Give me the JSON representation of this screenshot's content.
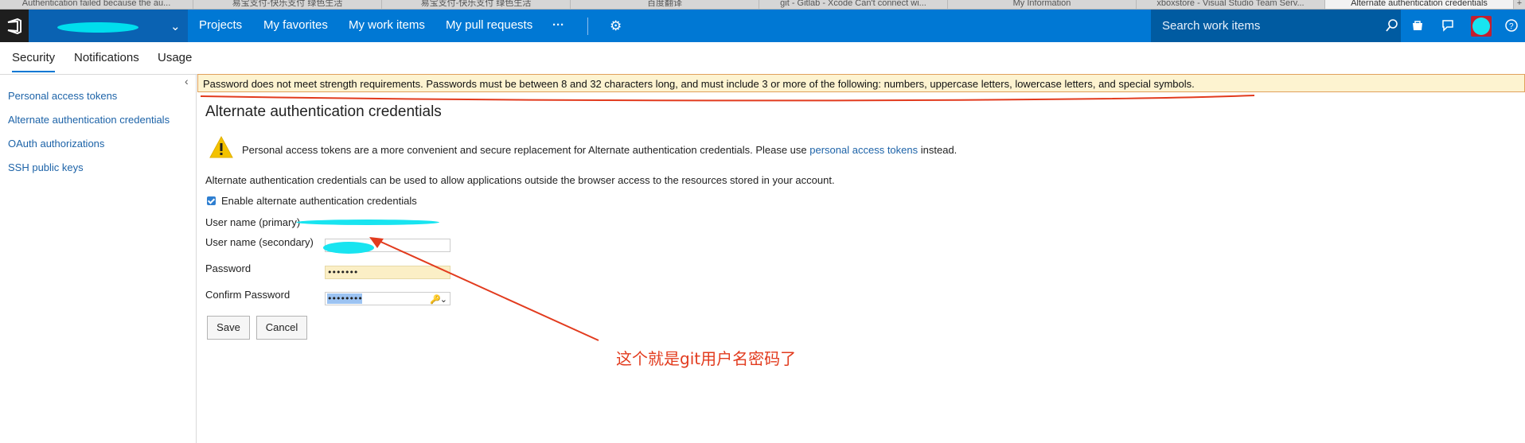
{
  "browser_tabs": [
    {
      "label": "Authentication failed because the au...",
      "active": false
    },
    {
      "label": "易宝支付-快乐支付 绿色生活",
      "active": false
    },
    {
      "label": "易宝支付-快乐支付 绿色生活",
      "active": false
    },
    {
      "label": "百度翻译",
      "active": false
    },
    {
      "label": "git - Gitlab - Xcode Can't connect wi...",
      "active": false
    },
    {
      "label": "My Information",
      "active": false
    },
    {
      "label": "xboxstore - Visual Studio Team Serv...",
      "active": false
    },
    {
      "label": "Alternate authentication credentials",
      "active": true
    }
  ],
  "topnav": {
    "items": [
      "Projects",
      "My favorites",
      "My work items",
      "My pull requests"
    ],
    "more": "···",
    "search_placeholder": "Search work items"
  },
  "subtabs": [
    "Security",
    "Notifications",
    "Usage"
  ],
  "sidebar": {
    "collapse": "‹",
    "links": [
      "Personal access tokens",
      "Alternate authentication credentials",
      "OAuth authorizations",
      "SSH public keys"
    ]
  },
  "banner": {
    "text": "Password does not meet strength requirements. Passwords must be between 8 and 32 characters long, and must include 3 or more of the following: numbers, uppercase letters, lowercase letters, and special symbols."
  },
  "main": {
    "title": "Alternate authentication credentials",
    "note_prefix": "Personal access tokens are a more convenient and secure replacement for Alternate authentication credentials. Please use",
    "note_link": "personal access tokens",
    "note_suffix": "instead.",
    "description": "Alternate authentication credentials can be used to allow applications outside the browser access to the resources stored in your account.",
    "enable_label": "Enable alternate authentication credentials",
    "enable_checked": true,
    "fields": {
      "username_primary_label": "User name (primary)",
      "username_secondary_label": "User name (secondary)",
      "password_label": "Password",
      "password_value": "•••••••",
      "confirm_label": "Confirm Password",
      "confirm_value": "••••••••"
    },
    "save": "Save",
    "cancel": "Cancel"
  },
  "annotation": "这个就是git用户名密码了",
  "colors": {
    "topbar": "#0078d4",
    "banner_bg": "#fdf3d0",
    "annotation": "#e23b1e",
    "redaction": "#18e4f0"
  }
}
